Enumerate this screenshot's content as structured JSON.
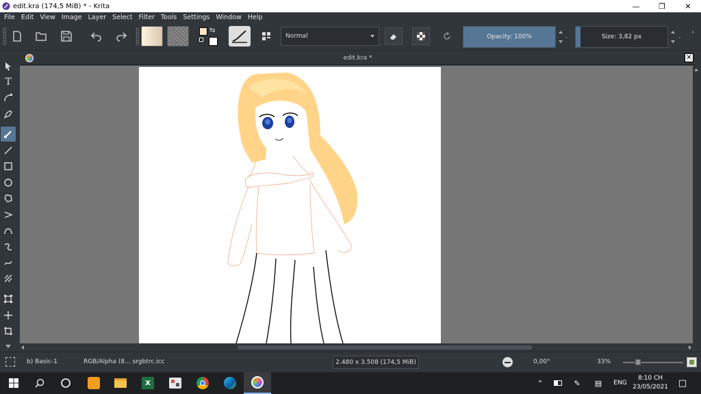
{
  "window": {
    "title": "edit.kra (174,5 MiB)  * - Krita",
    "minimize_icon": "minimize-icon",
    "maximize_icon": "restore-icon",
    "close_icon": "close-icon"
  },
  "menu": [
    "File",
    "Edit",
    "View",
    "Image",
    "Layer",
    "Select",
    "Filter",
    "Tools",
    "Settings",
    "Window",
    "Help"
  ],
  "toolbar": {
    "blend_mode": "Normal",
    "opacity_label": "Opacity: 100%",
    "opacity_value": 1.0,
    "size_label": "Size: 3,82 px",
    "size_fill": 0.05
  },
  "document": {
    "tab_title": "edit.kra *"
  },
  "status": {
    "brush_preset": "b) Basic-1",
    "color_space": "RGB/Alpha (8...  srgbtrc.icc",
    "image_size": "2.480 x 3.508 (174,5 MiB)",
    "rotation": "0,00°",
    "zoom": "33%",
    "zoom_fraction": 0.22
  },
  "taskbar": {
    "tray_language": "ENG",
    "time": "8:10 CH",
    "date": "23/05/2021"
  },
  "colors": {
    "accent": "#567695",
    "foreground_color": "#fbe6c8",
    "background_color": "#ffffff",
    "hair": "#ffcc73",
    "eyes": "#1e3fa0",
    "sketch_lines": "#f3b399"
  }
}
